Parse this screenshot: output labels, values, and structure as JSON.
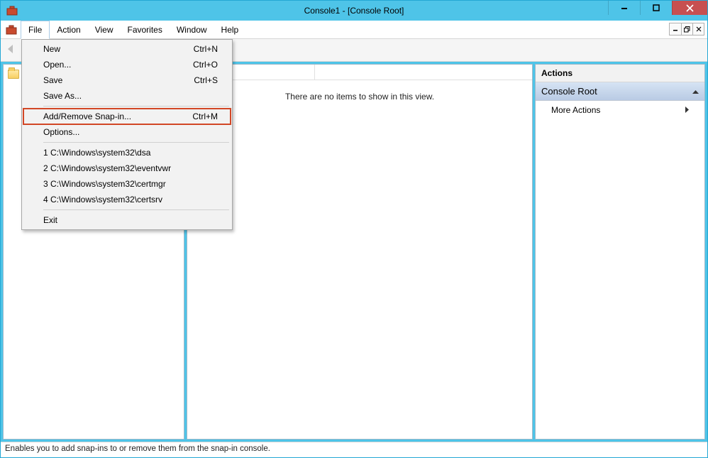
{
  "window": {
    "title": "Console1 - [Console Root]"
  },
  "menubar": {
    "items": [
      "File",
      "Action",
      "View",
      "Favorites",
      "Window",
      "Help"
    ]
  },
  "file_menu": {
    "new": {
      "label": "New",
      "shortcut": "Ctrl+N"
    },
    "open": {
      "label": "Open...",
      "shortcut": "Ctrl+O"
    },
    "save": {
      "label": "Save",
      "shortcut": "Ctrl+S"
    },
    "saveas": {
      "label": "Save As..."
    },
    "addremove": {
      "label": "Add/Remove Snap-in...",
      "shortcut": "Ctrl+M"
    },
    "options": {
      "label": "Options..."
    },
    "recent": [
      "1 C:\\Windows\\system32\\dsa",
      "2 C:\\Windows\\system32\\eventvwr",
      "3 C:\\Windows\\system32\\certmgr",
      "4 C:\\Windows\\system32\\certsrv"
    ],
    "exit": {
      "label": "Exit"
    }
  },
  "tree": {
    "root": "Console Root"
  },
  "main": {
    "empty_text": "There are no items to show in this view."
  },
  "actions": {
    "title": "Actions",
    "section": "Console Root",
    "link": "More Actions"
  },
  "statusbar": {
    "text": "Enables you to add snap-ins to or remove them from the snap-in console."
  }
}
